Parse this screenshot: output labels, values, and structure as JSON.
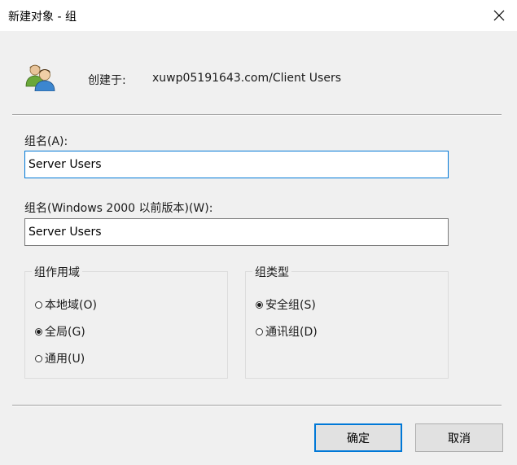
{
  "window": {
    "title": "新建对象 - 组"
  },
  "header": {
    "created_label": "创建于:",
    "created_value": "xuwp05191643.com/Client Users"
  },
  "group_name": {
    "label": "组名(A):",
    "value": "Server Users"
  },
  "group_name_pre2000": {
    "label": "组名(Windows 2000 以前版本)(W):",
    "value": "Server Users"
  },
  "scope": {
    "title": "组作用域",
    "options": [
      {
        "label": "本地域(O)",
        "checked": false
      },
      {
        "label": "全局(G)",
        "checked": true
      },
      {
        "label": "通用(U)",
        "checked": false
      }
    ]
  },
  "type": {
    "title": "组类型",
    "options": [
      {
        "label": "安全组(S)",
        "checked": true
      },
      {
        "label": "通讯组(D)",
        "checked": false
      }
    ]
  },
  "buttons": {
    "ok": "确定",
    "cancel": "取消"
  },
  "colors": {
    "accent": "#0078d7",
    "window_bg": "#f0f0f0"
  },
  "icons": {
    "group": "group-users-icon",
    "close": "close-icon"
  }
}
